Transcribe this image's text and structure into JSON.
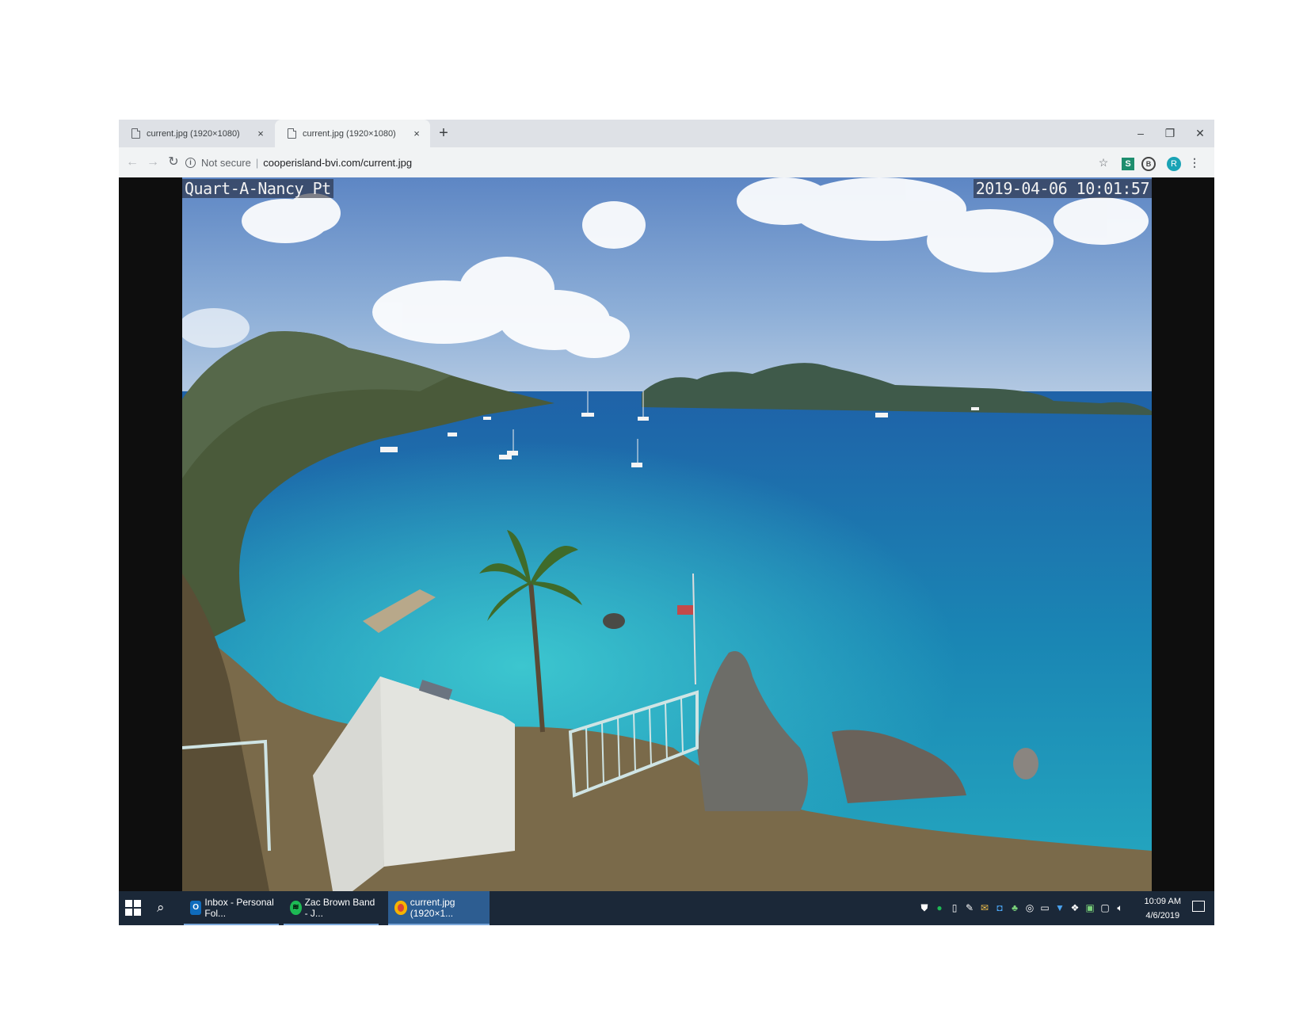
{
  "tabs": [
    {
      "title": "current.jpg (1920×1080)",
      "close": "×"
    },
    {
      "title": "current.jpg (1920×1080)",
      "close": "×"
    }
  ],
  "new_tab": "+",
  "window_controls": {
    "minimize": "–",
    "restore": "❐",
    "close": "✕"
  },
  "address_bar": {
    "security_label": "Not secure",
    "url": "cooperisland-bvi.com/current.jpg"
  },
  "webcam": {
    "location_label": "Quart-A-Nancy Pt",
    "timestamp": "2019-04-06 10:01:57"
  },
  "taskbar": {
    "items": [
      {
        "label": "Inbox - Personal Fol...",
        "icon": "outlook-icon",
        "color": "#0f6cbd"
      },
      {
        "label": "Zac Brown Band - J...",
        "icon": "spotify-icon",
        "color": "#1db954"
      },
      {
        "label": "current.jpg (1920×1...",
        "icon": "chrome-icon",
        "color": "#db4437"
      }
    ],
    "clock": {
      "time": "10:09 AM",
      "date": "4/6/2019"
    }
  },
  "colors": {
    "accent": "#2d5d91",
    "taskbar": "#1b2838",
    "profile": "#1aa3b5"
  }
}
